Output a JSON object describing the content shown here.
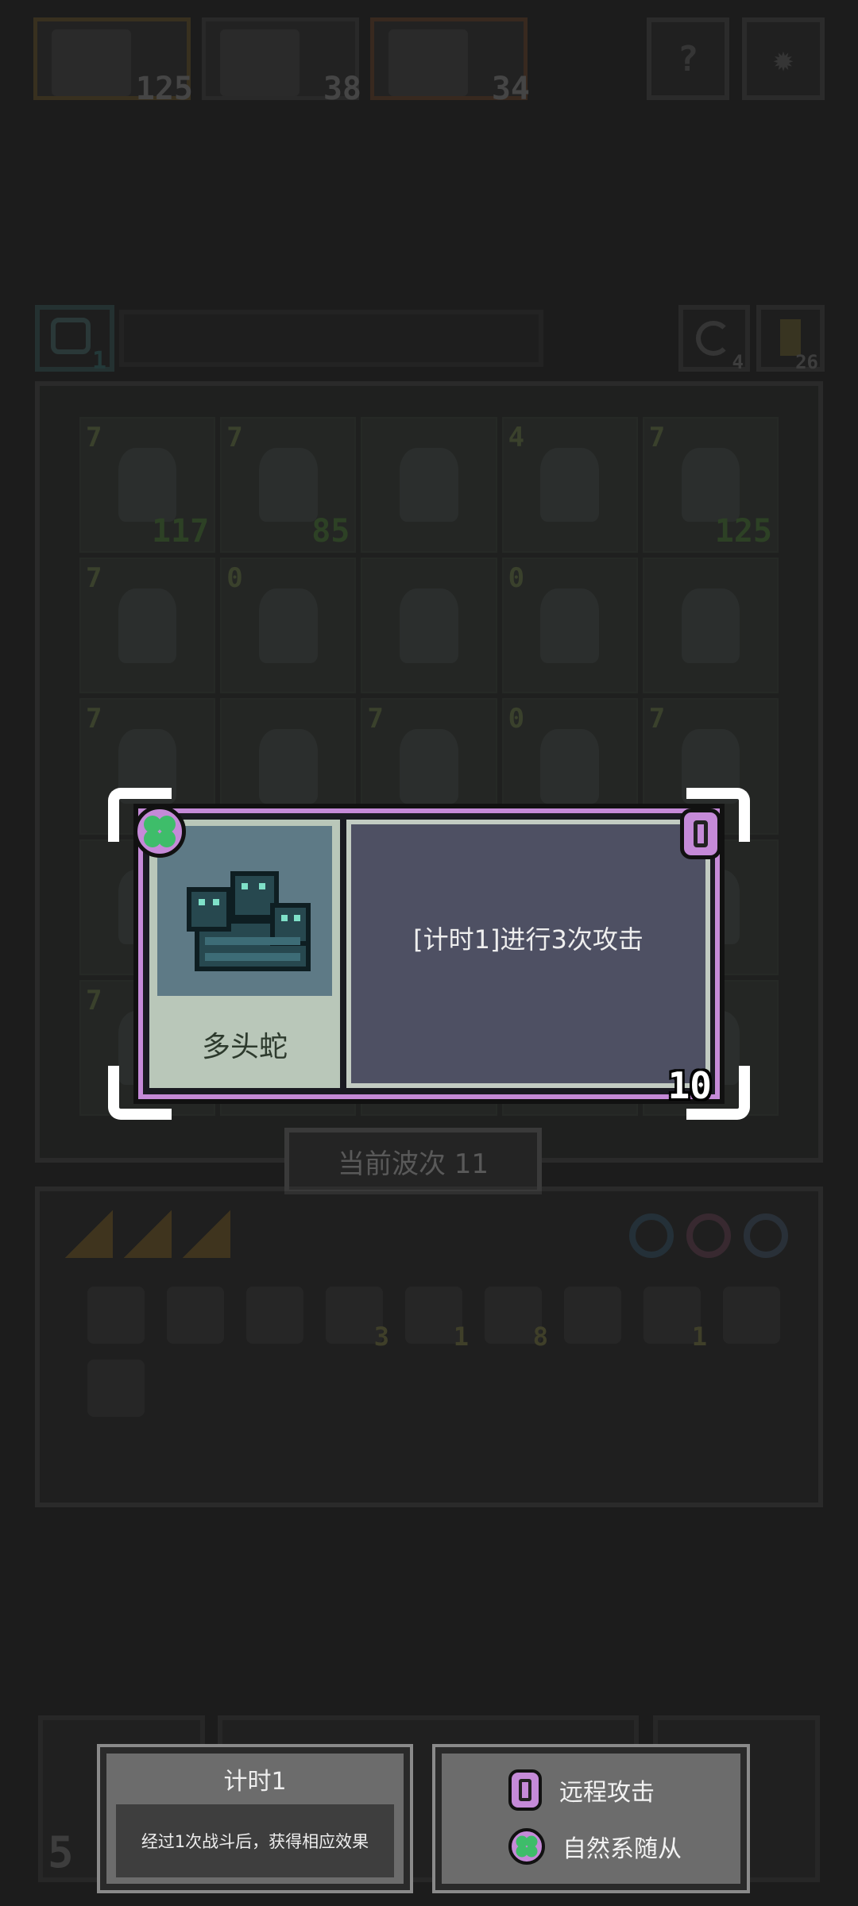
{
  "heroes": [
    {
      "count": "125",
      "color": "#5a4a24"
    },
    {
      "count": "38",
      "color": "#3a3a3a"
    },
    {
      "count": "34",
      "color": "#5a3a24"
    }
  ],
  "top_buttons": {
    "help_icon": "question-icon",
    "settings_icon": "gear-icon"
  },
  "mid_bar": {
    "time_count": "1",
    "reroll_count": "4",
    "key_count": "26"
  },
  "board": {
    "rows": [
      [
        {
          "tier": "7",
          "hp": "117"
        },
        {
          "tier": "7",
          "hp": "85"
        },
        {
          "tier": "",
          "hp": ""
        },
        {
          "tier": "4",
          "hp": ""
        },
        {
          "tier": "7",
          "hp": "125"
        }
      ],
      [
        {
          "tier": "7",
          "hp": ""
        },
        {
          "tier": "0",
          "hp": ""
        },
        {
          "tier": "",
          "hp": ""
        },
        {
          "tier": "0",
          "hp": ""
        },
        {
          "tier": "",
          "hp": ""
        }
      ],
      [
        {
          "tier": "7",
          "hp": ""
        },
        {
          "tier": "",
          "hp": ""
        },
        {
          "tier": "7",
          "hp": ""
        },
        {
          "tier": "0",
          "hp": ""
        },
        {
          "tier": "7",
          "hp": ""
        }
      ],
      [
        {
          "tier": "",
          "hp": ""
        },
        {
          "tier": "",
          "hp": ""
        },
        {
          "tier": "",
          "hp": ""
        },
        {
          "tier": "",
          "hp": ""
        },
        {
          "tier": "",
          "hp": ""
        }
      ],
      [
        {
          "tier": "7",
          "hp": ""
        },
        {
          "tier": "",
          "hp": ""
        },
        {
          "tier": "",
          "hp": ""
        },
        {
          "tier": "",
          "hp": ""
        },
        {
          "tier": "",
          "hp": ""
        }
      ]
    ]
  },
  "wave_label": "当前波次 11",
  "inventory": {
    "item_badges": [
      "",
      "",
      "",
      "3",
      "1",
      "8",
      "",
      "1"
    ]
  },
  "bottom": {
    "left_count": "5"
  },
  "card": {
    "name": "多头蛇",
    "description": "[计时1]进行3次攻击",
    "cost": "10",
    "class_icon": "clover-icon",
    "type_icon": "bow-badge-icon",
    "colors": {
      "frame": "#c58ad8",
      "panel": "#4e5063",
      "portrait": "#5e7a86",
      "name_bg": "#b9c7b9"
    }
  },
  "tooltips": {
    "timer": {
      "title": "计时1",
      "body": "经过1次战斗后，获得相应效果"
    },
    "tags": [
      {
        "icon": "bow-badge-icon",
        "label": "远程攻击"
      },
      {
        "icon": "clover-icon",
        "label": "自然系随从"
      }
    ]
  }
}
